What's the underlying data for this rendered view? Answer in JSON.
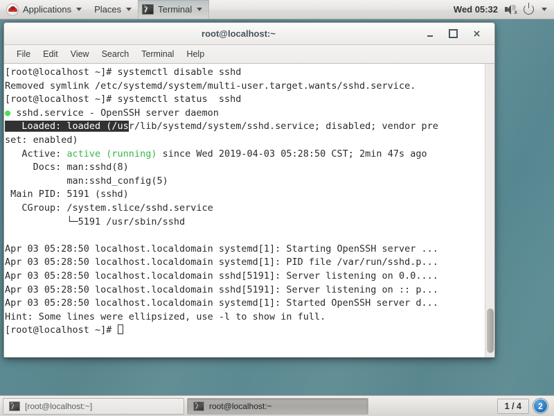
{
  "top_panel": {
    "applications_label": "Applications",
    "places_label": "Places",
    "terminal_label": "Terminal",
    "clock": "Wed 05:32",
    "logo_icon": "redhat-logo-icon",
    "volume_icon": "volume-muted-icon",
    "power_icon": "power-icon"
  },
  "window": {
    "title": "root@localhost:~",
    "minimize_label": "",
    "maximize_label": "",
    "close_label": "×",
    "menus": [
      {
        "label": "File"
      },
      {
        "label": "Edit"
      },
      {
        "label": "View"
      },
      {
        "label": "Search"
      },
      {
        "label": "Terminal"
      },
      {
        "label": "Help"
      }
    ]
  },
  "terminal": {
    "lines": [
      {
        "id": "l1",
        "text": "[root@localhost ~]# systemctl disable sshd"
      },
      {
        "id": "l2",
        "text": "Removed symlink /etc/systemd/system/multi-user.target.wants/sshd.service."
      },
      {
        "id": "l3",
        "text": "[root@localhost ~]# systemctl status  sshd"
      },
      {
        "id": "l4",
        "bullet": "●",
        "text": " sshd.service - OpenSSH server daemon"
      },
      {
        "id": "l5",
        "selected": "   Loaded: loaded (/us",
        "text": "r/lib/systemd/system/sshd.service; disabled; vendor pre"
      },
      {
        "id": "l6",
        "text": "set: enabled)"
      },
      {
        "id": "l7",
        "pre": "   Active: ",
        "accent": "active (running)",
        "post": " since Wed 2019-04-03 05:28:50 CST; 2min 47s ago"
      },
      {
        "id": "l8",
        "text": "     Docs: man:sshd(8)"
      },
      {
        "id": "l9",
        "text": "           man:sshd_config(5)"
      },
      {
        "id": "l10",
        "text": " Main PID: 5191 (sshd)"
      },
      {
        "id": "l11",
        "text": "   CGroup: /system.slice/sshd.service"
      },
      {
        "id": "l12",
        "text": "           └─5191 /usr/sbin/sshd"
      },
      {
        "id": "l13",
        "text": ""
      },
      {
        "id": "l14",
        "text": "Apr 03 05:28:50 localhost.localdomain systemd[1]: Starting OpenSSH server ..."
      },
      {
        "id": "l15",
        "text": "Apr 03 05:28:50 localhost.localdomain systemd[1]: PID file /var/run/sshd.p..."
      },
      {
        "id": "l16",
        "text": "Apr 03 05:28:50 localhost.localdomain sshd[5191]: Server listening on 0.0...."
      },
      {
        "id": "l17",
        "text": "Apr 03 05:28:50 localhost.localdomain sshd[5191]: Server listening on :: p..."
      },
      {
        "id": "l18",
        "text": "Apr 03 05:28:50 localhost.localdomain systemd[1]: Started OpenSSH server d..."
      },
      {
        "id": "l19",
        "text": "Hint: Some lines were ellipsized, use -l to show in full."
      },
      {
        "id": "l20",
        "text": "[root@localhost ~]# ",
        "cursor": true
      }
    ],
    "accent_color": "#39b54a",
    "status_dot_color": "#4ee04e",
    "selection_bg": "#323232"
  },
  "bottom_panel": {
    "tasks": [
      {
        "label": "[root@localhost:~]",
        "state": "minimized"
      },
      {
        "label": "root@localhost:~",
        "state": "active"
      }
    ],
    "workspace": "1 / 4",
    "notification_count": "2"
  }
}
